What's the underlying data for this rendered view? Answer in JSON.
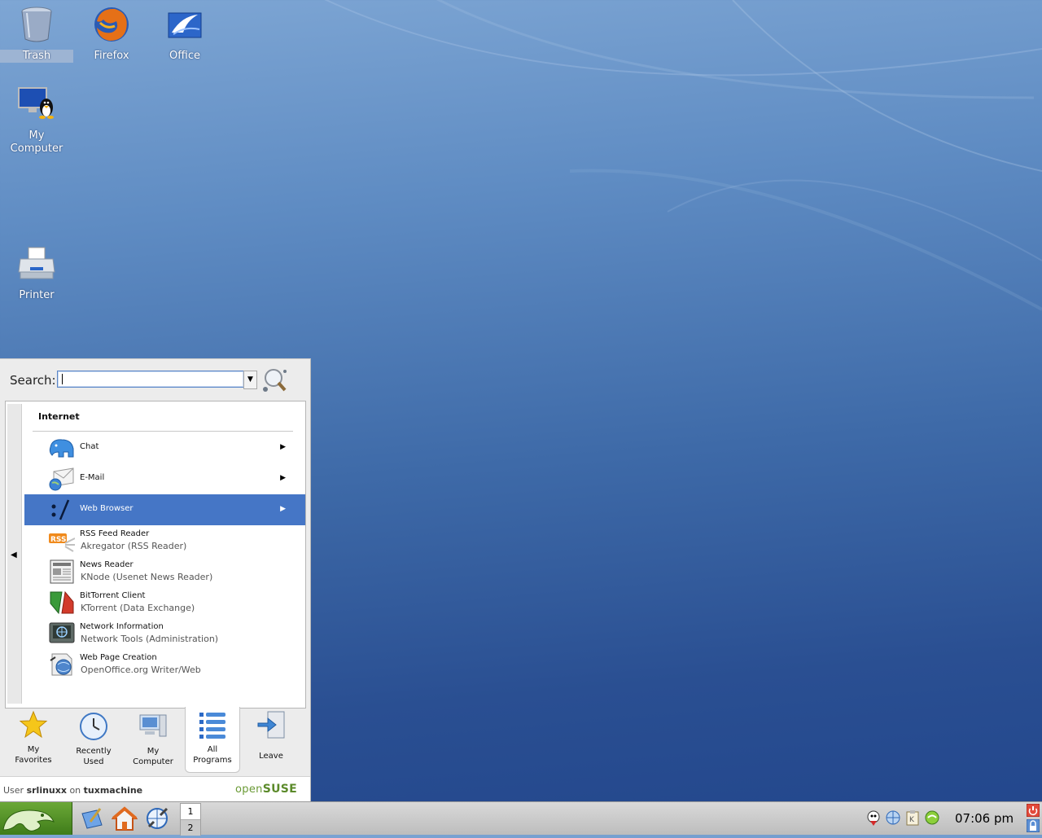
{
  "desktop": {
    "icons": [
      {
        "label": "Trash",
        "icon": "trash-icon"
      },
      {
        "label": "Firefox",
        "icon": "firefox-icon"
      },
      {
        "label": "Office",
        "icon": "office-icon"
      },
      {
        "label_line1": "My",
        "label_line2": "Computer",
        "icon": "computer-icon"
      },
      {
        "label": "Printer",
        "icon": "printer-icon"
      }
    ]
  },
  "kickoff": {
    "search_label": "Search:",
    "search_value": "",
    "section_title": "Internet",
    "items": [
      {
        "title": "Chat",
        "icon": "chat-icon",
        "has_submenu": true
      },
      {
        "title": "E-Mail",
        "icon": "email-icon",
        "has_submenu": true
      },
      {
        "title": "Web Browser",
        "icon": "web-browser-icon",
        "has_submenu": true,
        "highlighted": true
      },
      {
        "title": "RSS Feed Reader",
        "subtitle": "Akregator (RSS Reader)",
        "icon": "rss-icon"
      },
      {
        "title": "News Reader",
        "subtitle": "KNode (Usenet News Reader)",
        "icon": "news-icon"
      },
      {
        "title": "BitTorrent Client",
        "subtitle": "KTorrent (Data Exchange)",
        "icon": "bittorrent-icon"
      },
      {
        "title": "Network Information",
        "subtitle": "Network Tools (Administration)",
        "icon": "network-icon"
      },
      {
        "title": "Web Page Creation",
        "subtitle": "OpenOffice.org Writer/Web",
        "icon": "web-page-icon"
      }
    ],
    "tabs": [
      {
        "line1": "My",
        "line2": "Favorites",
        "icon": "star-icon"
      },
      {
        "line1": "Recently",
        "line2": "Used",
        "icon": "clock-icon"
      },
      {
        "line1": "My",
        "line2": "Computer",
        "icon": "computer-icon"
      },
      {
        "line1": "All",
        "line2": "Programs",
        "icon": "list-icon",
        "active": true
      },
      {
        "line1": "Leave",
        "line2": "",
        "icon": "leave-icon"
      }
    ],
    "footer": {
      "user_prefix": "User",
      "username": "srlinuxx",
      "on": "on",
      "hostname": "tuxmachine",
      "brand_open": "open",
      "brand_suse": "SUSE"
    }
  },
  "taskbar": {
    "pager": [
      "1",
      "2"
    ],
    "clock": "07:06 pm"
  },
  "colors": {
    "highlight": "#4576c6",
    "suse_green": "#6a9a35"
  }
}
